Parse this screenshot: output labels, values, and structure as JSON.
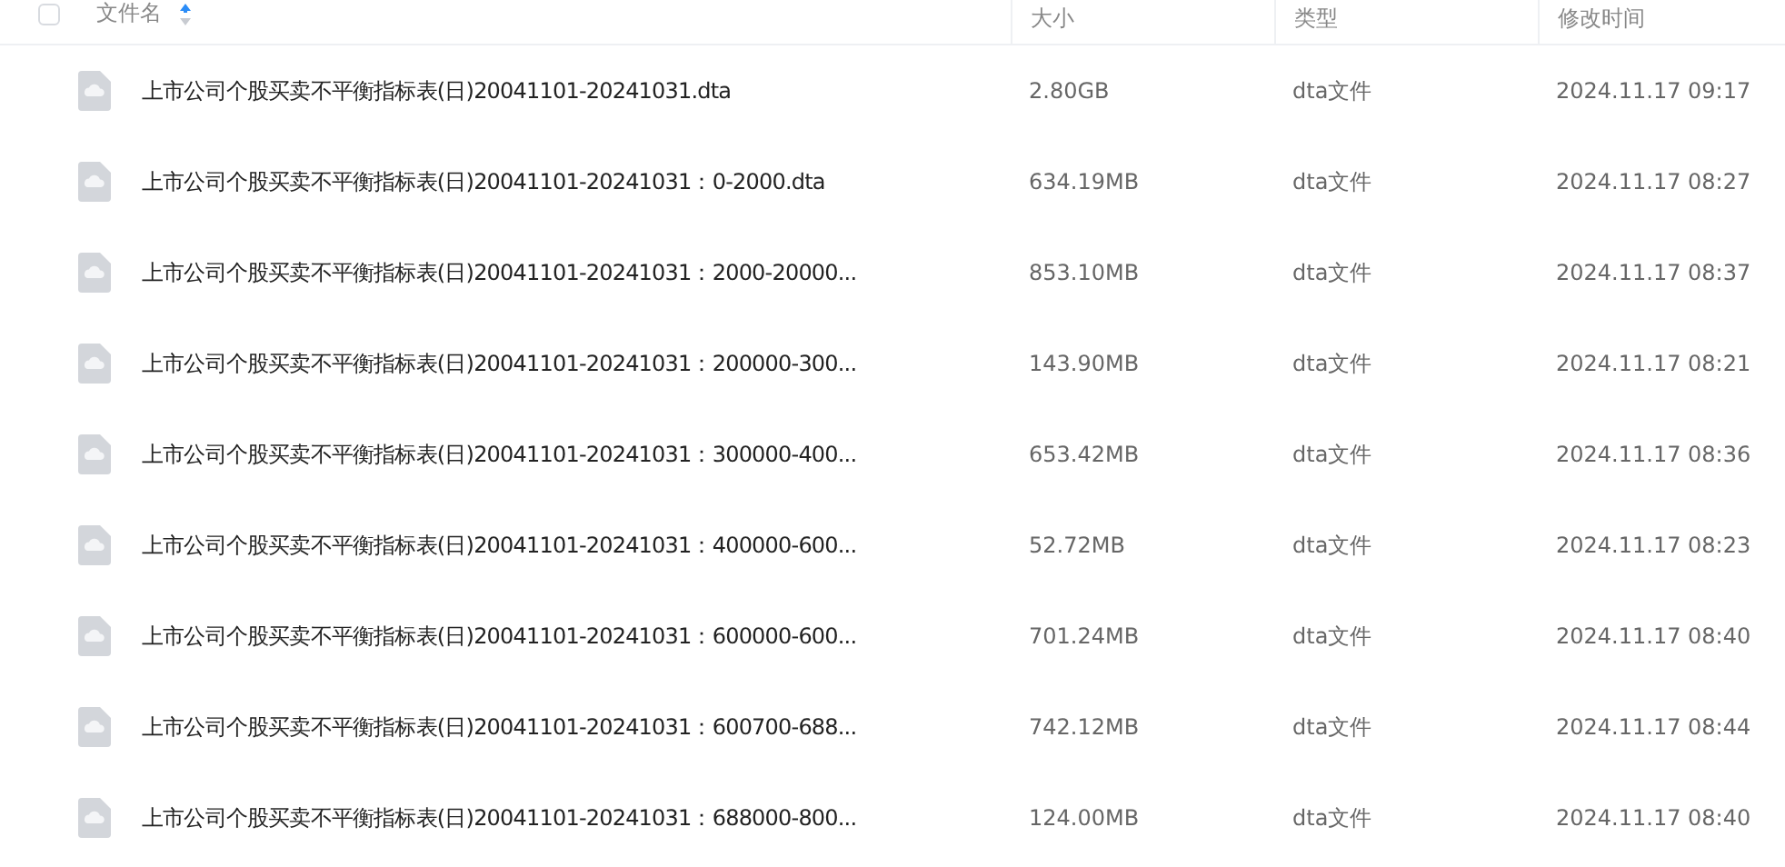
{
  "table": {
    "select_all": {
      "checked": false
    },
    "columns": [
      {
        "label": "文件名",
        "sort_ascending": true
      },
      {
        "label": "大小"
      },
      {
        "label": "类型"
      },
      {
        "label": "修改时间"
      }
    ],
    "rows": [
      {
        "name": "上市公司个股买卖不平衡指标表(日)20041101-20241031.dta",
        "size": "2.80GB",
        "type": "dta文件",
        "modified": "2024.11.17 09:17"
      },
      {
        "name": "上市公司个股买卖不平衡指标表(日)20041101-20241031：0-2000.dta",
        "size": "634.19MB",
        "type": "dta文件",
        "modified": "2024.11.17 08:27"
      },
      {
        "name": "上市公司个股买卖不平衡指标表(日)20041101-20241031：2000-20000...",
        "size": "853.10MB",
        "type": "dta文件",
        "modified": "2024.11.17 08:37"
      },
      {
        "name": "上市公司个股买卖不平衡指标表(日)20041101-20241031：200000-300...",
        "size": "143.90MB",
        "type": "dta文件",
        "modified": "2024.11.17 08:21"
      },
      {
        "name": "上市公司个股买卖不平衡指标表(日)20041101-20241031：300000-400...",
        "size": "653.42MB",
        "type": "dta文件",
        "modified": "2024.11.17 08:36"
      },
      {
        "name": "上市公司个股买卖不平衡指标表(日)20041101-20241031：400000-600...",
        "size": "52.72MB",
        "type": "dta文件",
        "modified": "2024.11.17 08:23"
      },
      {
        "name": "上市公司个股买卖不平衡指标表(日)20041101-20241031：600000-600...",
        "size": "701.24MB",
        "type": "dta文件",
        "modified": "2024.11.17 08:40"
      },
      {
        "name": "上市公司个股买卖不平衡指标表(日)20041101-20241031：600700-688...",
        "size": "742.12MB",
        "type": "dta文件",
        "modified": "2024.11.17 08:44"
      },
      {
        "name": "上市公司个股买卖不平衡指标表(日)20041101-20241031：688000-800...",
        "size": "124.00MB",
        "type": "dta文件",
        "modified": "2024.11.17 08:40"
      }
    ]
  }
}
